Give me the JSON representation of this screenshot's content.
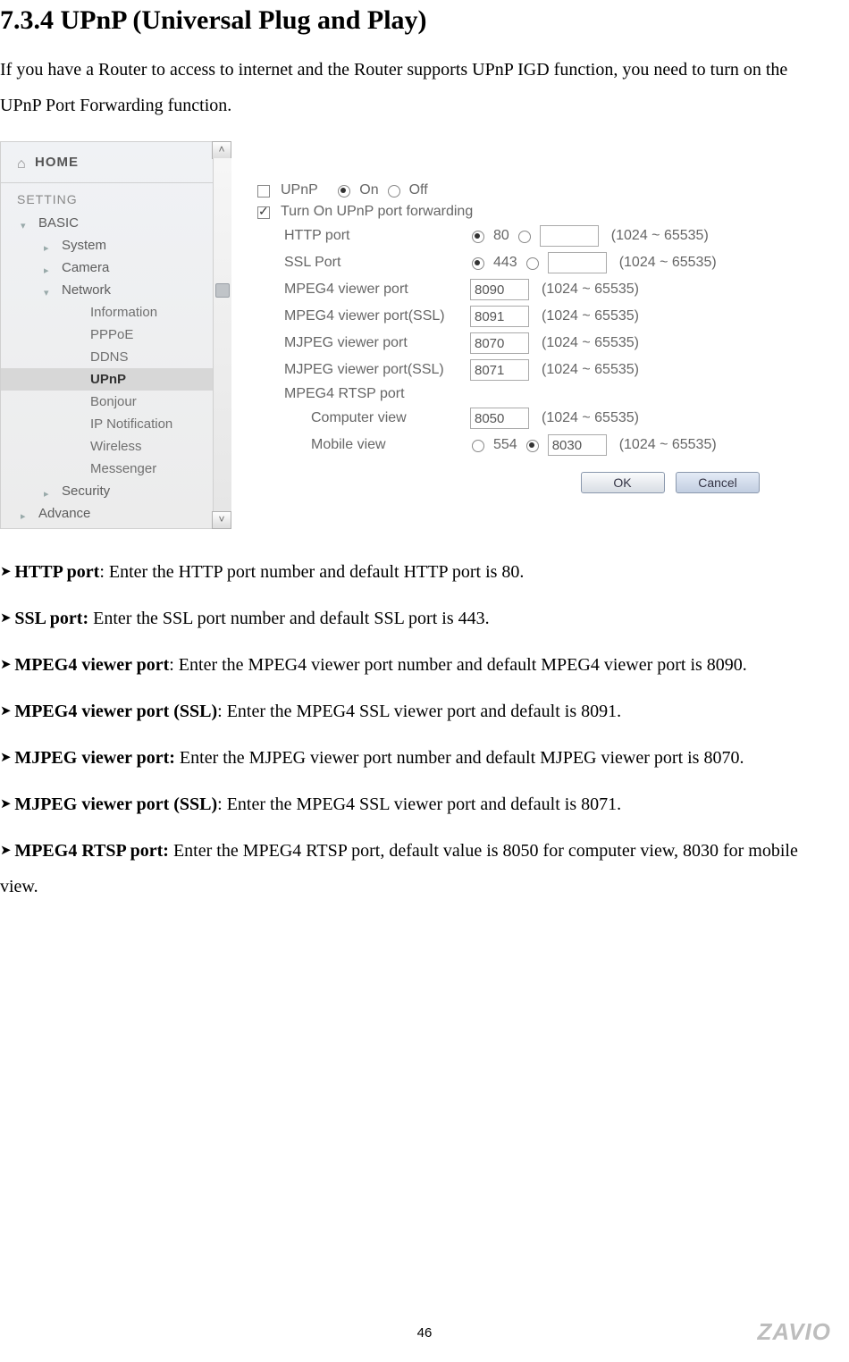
{
  "heading": "7.3.4 UPnP (Universal Plug and Play)",
  "intro": "If you have a Router to access to internet and the Router supports UPnP IGD function, you need to turn on the UPnP Port Forwarding function.",
  "sidebar": {
    "home": "HOME",
    "setting": "SETTING",
    "basic": "BASIC",
    "items_l2": {
      "system": "System",
      "camera": "Camera",
      "network": "Network",
      "security": "Security"
    },
    "items_l3": {
      "information": "Information",
      "pppoe": "PPPoE",
      "ddns": "DDNS",
      "upnp": "UPnP",
      "bonjour": "Bonjour",
      "ipnotif": "IP Notification",
      "wireless": "Wireless",
      "messenger": "Messenger"
    },
    "advance": "Advance"
  },
  "panel": {
    "upnp_label": "UPnP",
    "on": "On",
    "off": "Off",
    "turn_on": "Turn On UPnP port forwarding",
    "http_port": "HTTP port",
    "http_default": "80",
    "ssl_port": "SSL Port",
    "ssl_default": "443",
    "mpeg4_port": "MPEG4 viewer port",
    "mpeg4_val": "8090",
    "mpeg4_ssl_port": "MPEG4 viewer port(SSL)",
    "mpeg4_ssl_val": "8091",
    "mjpeg_port": "MJPEG viewer port",
    "mjpeg_val": "8070",
    "mjpeg_ssl_port": "MJPEG viewer port(SSL)",
    "mjpeg_ssl_val": "8071",
    "rtsp_header": "MPEG4 RTSP port",
    "computer_view": "Computer view",
    "computer_val": "8050",
    "mobile_view": "Mobile view",
    "mobile_default": "554",
    "mobile_val": "8030",
    "range": "(1024 ~ 65535)",
    "range2": "(1024 ~ 65535)",
    "ok": "OK",
    "cancel": "Cancel"
  },
  "desc": {
    "http": {
      "title": "HTTP port",
      "text": ": Enter the HTTP port number and default HTTP port is 80."
    },
    "ssl": {
      "title": "SSL port:",
      "text": " Enter the SSL port number and default SSL port is 443."
    },
    "mpeg4": {
      "title": "MPEG4 viewer port",
      "text": ": Enter the MPEG4 viewer port number and default MPEG4 viewer port is 8090."
    },
    "mpeg4ssl": {
      "title": "MPEG4 viewer port (SSL)",
      "text": ": Enter the MPEG4 SSL viewer port and default is 8091."
    },
    "mjpeg": {
      "title": "MJPEG viewer port:",
      "text": " Enter the MJPEG viewer port number and default MJPEG viewer port is 8070."
    },
    "mjpegssl": {
      "title": "MJPEG viewer port (SSL)",
      "text": ": Enter the MPEG4 SSL viewer port and default is 8071."
    },
    "rtsp": {
      "title": "MPEG4 RTSP port:",
      "text": " Enter the MPEG4 RTSP port, default value is 8050 for computer view, 8030 for mobile view."
    }
  },
  "page_number": "46",
  "logo": "ZAVIO"
}
